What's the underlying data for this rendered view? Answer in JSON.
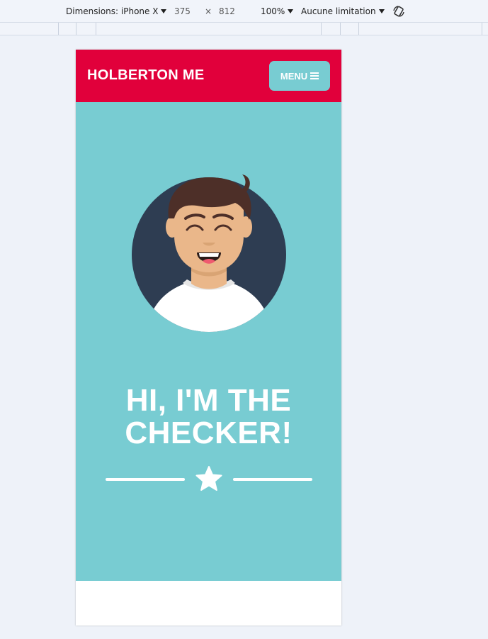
{
  "devtools": {
    "dimensions_label": "Dimensions: iPhone X",
    "width": "375",
    "separator": "×",
    "height": "812",
    "zoom": "100%",
    "throttle": "Aucune limitation",
    "rotate_icon": "rotate-icon"
  },
  "site": {
    "title": "HOLBERTON ME",
    "menu_label": "MENU",
    "menu_icon": "hamburger-icon",
    "hero_title_line1": "HI, I'M THE",
    "hero_title_line2": "CHECKER!",
    "divider_icon": "star-icon"
  },
  "colors": {
    "header": "#e1003b",
    "hero": "#78ccd2",
    "avatar_bg": "#2e3d52",
    "white": "#ffffff"
  }
}
